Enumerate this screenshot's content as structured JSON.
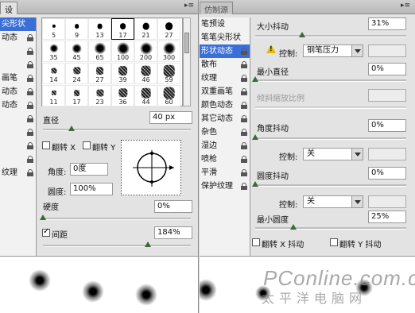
{
  "left_panel": {
    "tab": "设",
    "sidebar": [
      {
        "label": "尖形状",
        "selected": true,
        "locked": false
      },
      {
        "label": "动态",
        "selected": false,
        "locked": true
      },
      {
        "label": "",
        "selected": false,
        "locked": true
      },
      {
        "label": "",
        "selected": false,
        "locked": true
      },
      {
        "label": "画笔",
        "selected": false,
        "locked": true
      },
      {
        "label": "动态",
        "selected": false,
        "locked": true
      },
      {
        "label": "动态",
        "selected": false,
        "locked": true
      },
      {
        "label": "",
        "selected": false,
        "locked": true
      },
      {
        "label": "",
        "selected": false,
        "locked": true
      },
      {
        "label": "",
        "selected": false,
        "locked": true
      },
      {
        "label": "",
        "selected": false,
        "locked": true
      },
      {
        "label": "纹理",
        "selected": false,
        "locked": true
      }
    ],
    "brush_sizes": [
      "5",
      "9",
      "13",
      "17",
      "21",
      "27",
      "35",
      "45",
      "65",
      "100",
      "200",
      "300",
      "14",
      "24",
      "27",
      "39",
      "46",
      "59",
      "11",
      "17",
      "23",
      "36",
      "44",
      "60"
    ],
    "brush_types": [
      "hard",
      "hard",
      "hard",
      "hard",
      "hard",
      "hard",
      "soft",
      "soft",
      "soft",
      "soft",
      "soft",
      "soft",
      "texture",
      "texture",
      "texture",
      "texture",
      "texture",
      "texture",
      "texture",
      "texture",
      "texture",
      "texture",
      "texture",
      "texture"
    ],
    "selected_brush_index": 3,
    "diameter_label": "直径",
    "diameter_value": "40 px",
    "flip_x_label": "翻转 X",
    "flip_y_label": "翻转 Y",
    "angle_label": "角度:",
    "angle_value": "0度",
    "roundness_label": "圆度:",
    "roundness_value": "100%",
    "hardness_label": "硬度",
    "hardness_value": "0%",
    "spacing_label": "间距",
    "spacing_value": "184%",
    "spacing_checked": true
  },
  "right_panel": {
    "tab": "仿制源",
    "sidebar": [
      {
        "label": "笔预设",
        "selected": false,
        "locked": false
      },
      {
        "label": "笔笔尖形状",
        "selected": false,
        "locked": false
      },
      {
        "label": "形状动态",
        "selected": true,
        "locked": true
      },
      {
        "label": "散布",
        "selected": false,
        "locked": true
      },
      {
        "label": "纹理",
        "selected": false,
        "locked": true
      },
      {
        "label": "双重画笔",
        "selected": false,
        "locked": true
      },
      {
        "label": "颜色动态",
        "selected": false,
        "locked": true
      },
      {
        "label": "其它动态",
        "selected": false,
        "locked": true
      },
      {
        "label": "杂色",
        "selected": false,
        "locked": true
      },
      {
        "label": "湿边",
        "selected": false,
        "locked": true
      },
      {
        "label": "喷枪",
        "selected": false,
        "locked": true
      },
      {
        "label": "平滑",
        "selected": false,
        "locked": true
      },
      {
        "label": "保护纹理",
        "selected": false,
        "locked": true
      }
    ],
    "size_jitter_label": "大小抖动",
    "size_jitter_value": "31%",
    "control_label": "控制:",
    "control_value_1": "钢笔压力",
    "min_diameter_label": "最小直径",
    "min_diameter_value": "0%",
    "tilt_scale_label": "倾斜缩放比例",
    "angle_jitter_label": "角度抖动",
    "angle_jitter_value": "0%",
    "control_value_2": "关",
    "roundness_jitter_label": "圆度抖动",
    "roundness_jitter_value": "0%",
    "control_value_3": "关",
    "min_roundness_label": "最小圆度",
    "min_roundness_value": "25%",
    "flip_x_jitter_label": "翻转 X 抖动",
    "flip_y_jitter_label": "翻转 Y 抖动",
    "watermark": "PConline.com.cn",
    "watermark_sub": "太平洋电脑网"
  },
  "colors": {
    "selection": "#3a6fd8",
    "panel": "#e3e3e3"
  }
}
